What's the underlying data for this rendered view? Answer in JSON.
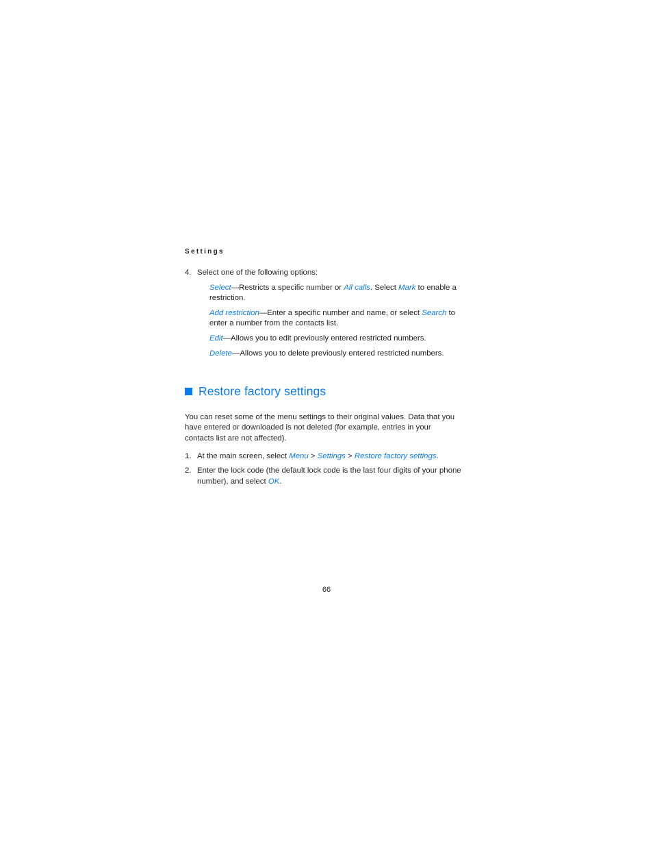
{
  "document": {
    "running_head": "Settings",
    "page_number": "66",
    "accent_color": "#0a7bec",
    "text_color": "#231f20",
    "background_color": "#ffffff"
  },
  "list_step_4": {
    "number": "4.",
    "lead_in": "Select one of the following options:",
    "options": [
      {
        "term": "Select",
        "separator": "—",
        "text_parts": [
          {
            "text": "Restricts a specific number or ",
            "style": "plain"
          },
          {
            "text": "All calls",
            "style": "term"
          },
          {
            "text": ". Select ",
            "style": "plain"
          },
          {
            "text": "Mark",
            "style": "term"
          },
          {
            "text": " to enable a restriction.",
            "style": "plain"
          }
        ]
      },
      {
        "term": "Add restriction",
        "separator": "—",
        "text_parts": [
          {
            "text": "Enter a specific number and name, or select ",
            "style": "plain"
          },
          {
            "text": "Search",
            "style": "term"
          },
          {
            "text": " to enter a number from the contacts list.",
            "style": "plain"
          }
        ]
      },
      {
        "term": "Edit",
        "separator": "—",
        "text_parts": [
          {
            "text": "Allows you to edit previously entered restricted numbers.",
            "style": "plain"
          }
        ]
      },
      {
        "term": "Delete",
        "separator": "—",
        "text_parts": [
          {
            "text": "Allows you to delete previously entered restricted numbers.",
            "style": "plain"
          }
        ]
      }
    ]
  },
  "section": {
    "heading": "Restore factory settings",
    "bullet_icon": "filled-square-icon",
    "paragraph": "You can reset some of the menu settings to their original values. Data that you have entered or downloaded is not deleted (for example, entries in your contacts list are not affected).",
    "steps": [
      {
        "number": "1.",
        "parts": [
          {
            "text": "At the main screen, select ",
            "style": "plain"
          },
          {
            "text": "Menu",
            "style": "term"
          },
          {
            "text": " > ",
            "style": "plain"
          },
          {
            "text": "Settings",
            "style": "term"
          },
          {
            "text": " > ",
            "style": "plain"
          },
          {
            "text": "Restore factory settings",
            "style": "term"
          },
          {
            "text": ".",
            "style": "plain"
          }
        ]
      },
      {
        "number": "2.",
        "parts": [
          {
            "text": "Enter the lock code (the default lock code is the last four digits of your phone number), and select ",
            "style": "plain"
          },
          {
            "text": "OK",
            "style": "term"
          },
          {
            "text": ".",
            "style": "plain"
          }
        ]
      }
    ]
  }
}
